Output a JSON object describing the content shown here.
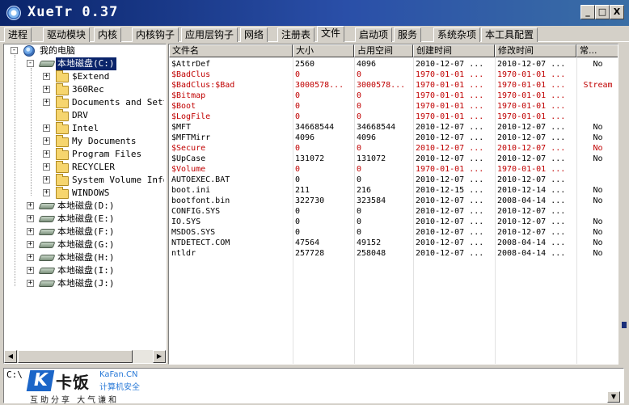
{
  "window": {
    "title": "XueTr 0.37",
    "minimize_label": "_",
    "maximize_label": "□",
    "close_label": "X"
  },
  "tabs": [
    {
      "label": "进程"
    },
    {
      "label": "驱动模块"
    },
    {
      "label": "内核"
    },
    {
      "label": "内核钩子"
    },
    {
      "label": "应用层钩子"
    },
    {
      "label": "网络"
    },
    {
      "label": "注册表"
    },
    {
      "label": "文件",
      "active": true
    },
    {
      "label": "启动项"
    },
    {
      "label": "服务"
    },
    {
      "label": "系统杂项"
    },
    {
      "label": "本工具配置"
    }
  ],
  "tree": {
    "root": {
      "label": "我的电脑",
      "expander": "-"
    },
    "drive_c": {
      "label": "本地磁盘(C:)",
      "expander": "-",
      "selected": true
    },
    "folders": [
      {
        "label": "$Extend",
        "expander": "+"
      },
      {
        "label": "360Rec",
        "expander": "+"
      },
      {
        "label": "Documents and Setti",
        "expander": "+"
      },
      {
        "label": "DRV",
        "expander": ""
      },
      {
        "label": "Intel",
        "expander": "+"
      },
      {
        "label": "My Documents",
        "expander": "+"
      },
      {
        "label": "Program Files",
        "expander": "+"
      },
      {
        "label": "RECYCLER",
        "expander": "+"
      },
      {
        "label": "System Volume Inform",
        "expander": "+"
      },
      {
        "label": "WINDOWS",
        "expander": "+"
      }
    ],
    "drives": [
      {
        "label": "本地磁盘(D:)",
        "expander": "+"
      },
      {
        "label": "本地磁盘(E:)",
        "expander": "+"
      },
      {
        "label": "本地磁盘(F:)",
        "expander": "+"
      },
      {
        "label": "本地磁盘(G:)",
        "expander": "+"
      },
      {
        "label": "本地磁盘(H:)",
        "expander": "+"
      },
      {
        "label": "本地磁盘(I:)",
        "expander": "+"
      },
      {
        "label": "本地磁盘(J:)",
        "expander": "+"
      }
    ]
  },
  "table": {
    "headers": [
      "文件名",
      "大小",
      "占用空间",
      "创建时间",
      "修改时间",
      "常..."
    ],
    "rows": [
      {
        "name": "$AttrDef",
        "size": "2560",
        "alloc": "4096",
        "created": "2010-12-07 ...",
        "modified": "2010-12-07 ...",
        "flag": "No",
        "red": false
      },
      {
        "name": "$BadClus",
        "size": "0",
        "alloc": "0",
        "created": "1970-01-01 ...",
        "modified": "1970-01-01 ...",
        "flag": "",
        "red": true
      },
      {
        "name": "$BadClus:$Bad",
        "size": "3000578...",
        "alloc": "3000578...",
        "created": "1970-01-01 ...",
        "modified": "1970-01-01 ...",
        "flag": "Stream",
        "red": true
      },
      {
        "name": "$Bitmap",
        "size": "0",
        "alloc": "0",
        "created": "1970-01-01 ...",
        "modified": "1970-01-01 ...",
        "flag": "",
        "red": true
      },
      {
        "name": "$Boot",
        "size": "0",
        "alloc": "0",
        "created": "1970-01-01 ...",
        "modified": "1970-01-01 ...",
        "flag": "",
        "red": true
      },
      {
        "name": "$LogFile",
        "size": "0",
        "alloc": "0",
        "created": "1970-01-01 ...",
        "modified": "1970-01-01 ...",
        "flag": "",
        "red": true
      },
      {
        "name": "$MFT",
        "size": "34668544",
        "alloc": "34668544",
        "created": "2010-12-07 ...",
        "modified": "2010-12-07 ...",
        "flag": "No",
        "red": false
      },
      {
        "name": "$MFTMirr",
        "size": "4096",
        "alloc": "4096",
        "created": "2010-12-07 ...",
        "modified": "2010-12-07 ...",
        "flag": "No",
        "red": false
      },
      {
        "name": "$Secure",
        "size": "0",
        "alloc": "0",
        "created": "2010-12-07 ...",
        "modified": "2010-12-07 ...",
        "flag": "No",
        "red": true
      },
      {
        "name": "$UpCase",
        "size": "131072",
        "alloc": "131072",
        "created": "2010-12-07 ...",
        "modified": "2010-12-07 ...",
        "flag": "No",
        "red": false
      },
      {
        "name": "$Volume",
        "size": "0",
        "alloc": "0",
        "created": "1970-01-01 ...",
        "modified": "1970-01-01 ...",
        "flag": "",
        "red": true
      },
      {
        "name": "AUTOEXEC.BAT",
        "size": "0",
        "alloc": "0",
        "created": "2010-12-07 ...",
        "modified": "2010-12-07 ...",
        "flag": "",
        "red": false
      },
      {
        "name": "boot.ini",
        "size": "211",
        "alloc": "216",
        "created": "2010-12-15 ...",
        "modified": "2010-12-14 ...",
        "flag": "No",
        "red": false
      },
      {
        "name": "bootfont.bin",
        "size": "322730",
        "alloc": "323584",
        "created": "2010-12-07 ...",
        "modified": "2008-04-14 ...",
        "flag": "No",
        "red": false
      },
      {
        "name": "CONFIG.SYS",
        "size": "0",
        "alloc": "0",
        "created": "2010-12-07 ...",
        "modified": "2010-12-07 ...",
        "flag": "",
        "red": false
      },
      {
        "name": "IO.SYS",
        "size": "0",
        "alloc": "0",
        "created": "2010-12-07 ...",
        "modified": "2010-12-07 ...",
        "flag": "No",
        "red": false
      },
      {
        "name": "MSDOS.SYS",
        "size": "0",
        "alloc": "0",
        "created": "2010-12-07 ...",
        "modified": "2010-12-07 ...",
        "flag": "No",
        "red": false
      },
      {
        "name": "NTDETECT.COM",
        "size": "47564",
        "alloc": "49152",
        "created": "2010-12-07 ...",
        "modified": "2008-04-14 ...",
        "flag": "No",
        "red": false
      },
      {
        "name": "ntldr",
        "size": "257728",
        "alloc": "258048",
        "created": "2010-12-07 ...",
        "modified": "2008-04-14 ...",
        "flag": "No",
        "red": false
      }
    ]
  },
  "status": {
    "path": "C:\\"
  },
  "watermark": {
    "brand": "卡饭",
    "site": "KaFan.CN",
    "subtitle": "计算机安全",
    "tagline": "互助分享  大气谦和"
  },
  "colors": {
    "deleted_or_special": "#c00000",
    "selection": "#0a246a",
    "titlebar": "#0a246a"
  }
}
